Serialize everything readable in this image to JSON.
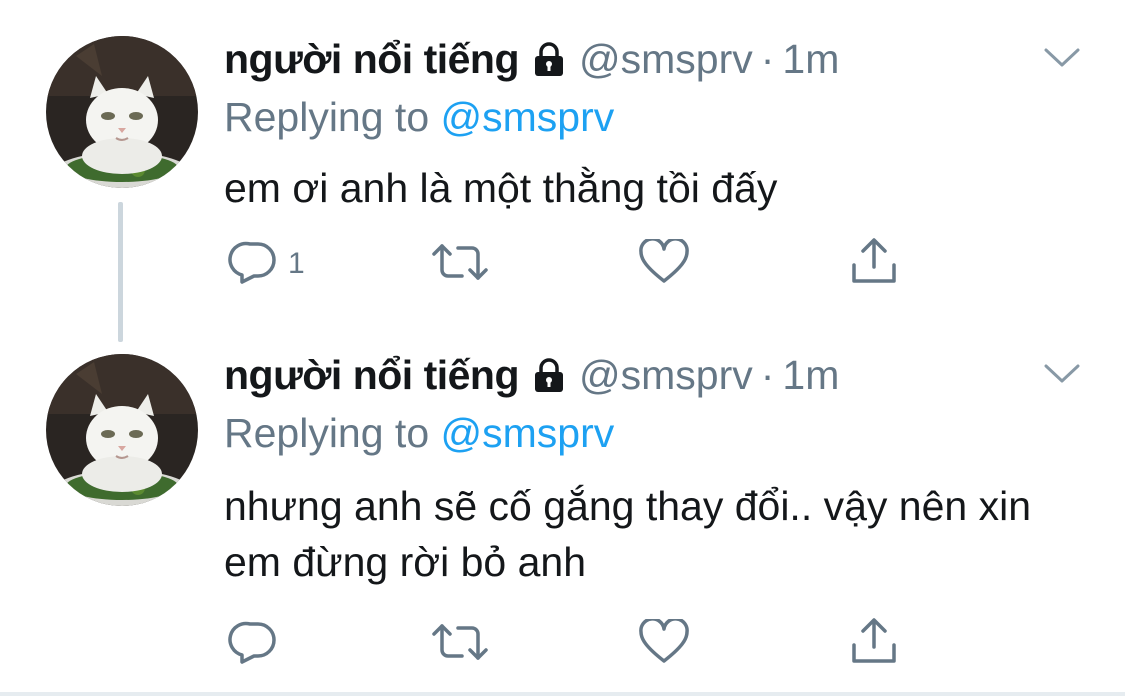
{
  "tweets": [
    {
      "display_name": "người nổi tiếng",
      "handle": "@smsprv",
      "separator": "·",
      "time": "1m",
      "replying_prefix": "Replying to ",
      "replying_handle": "@smsprv",
      "text": "em ơi anh là một thằng tồi đấy",
      "reply_count": "1"
    },
    {
      "display_name": "người nổi tiếng",
      "handle": "@smsprv",
      "separator": "·",
      "time": "1m",
      "replying_prefix": "Replying to ",
      "replying_handle": "@smsprv",
      "text": "nhưng anh sẽ cố gắng thay đổi.. vậy nên xin em đừng rời bỏ anh",
      "reply_count": ""
    }
  ],
  "icons": {
    "lock": "lock-icon",
    "caret": "chevron-down-icon",
    "reply": "reply-icon",
    "retweet": "retweet-icon",
    "like": "heart-icon",
    "share": "share-icon"
  },
  "colors": {
    "text": "#14171a",
    "muted": "#657786",
    "link": "#1da1f2",
    "thread_line": "#ccd6dd",
    "divider": "#e6ecf0"
  }
}
